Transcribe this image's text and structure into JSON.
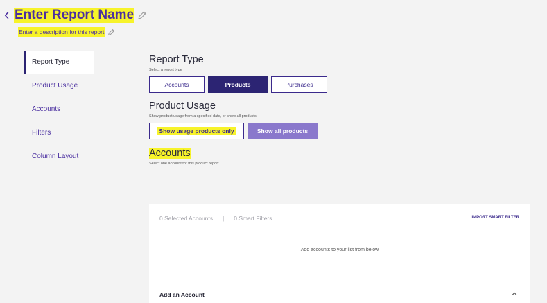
{
  "header": {
    "back_glyph": "‹",
    "title": "Enter Report Name",
    "description": "Enter a description for this report"
  },
  "sidebar": {
    "items": [
      {
        "label": "Report Type",
        "active": true
      },
      {
        "label": "Product Usage"
      },
      {
        "label": "Accounts"
      },
      {
        "label": "Filters"
      },
      {
        "label": "Column Layout"
      }
    ]
  },
  "report_type": {
    "title": "Report Type",
    "subtitle": "Select a report type",
    "options": [
      "Accounts",
      "Products",
      "Purchases"
    ],
    "selected": "Products"
  },
  "product_usage": {
    "title": "Product Usage",
    "subtitle": "Show product usage from a specified date, or show all products",
    "usage_only_label": "Show usage products only",
    "show_all_label": "Show all products"
  },
  "accounts": {
    "title": "Accounts",
    "subtitle": "Select one account for this product report",
    "selected_count": "0 Selected Accounts",
    "separator": "|",
    "smart_filters": "0 Smart Filters",
    "import_label": "IMPORT SMART FILTER",
    "empty_message": "Add accounts to your list from below",
    "add_label": "Add an Account"
  },
  "colors": {
    "accent": "#4b2fa0",
    "selected_button": "#2c2473",
    "secondary_button": "#8a78cc",
    "highlight": "#f7f32a"
  },
  "icons": [
    "back-chevron-icon",
    "pencil-icon",
    "chevron-up-icon"
  ]
}
